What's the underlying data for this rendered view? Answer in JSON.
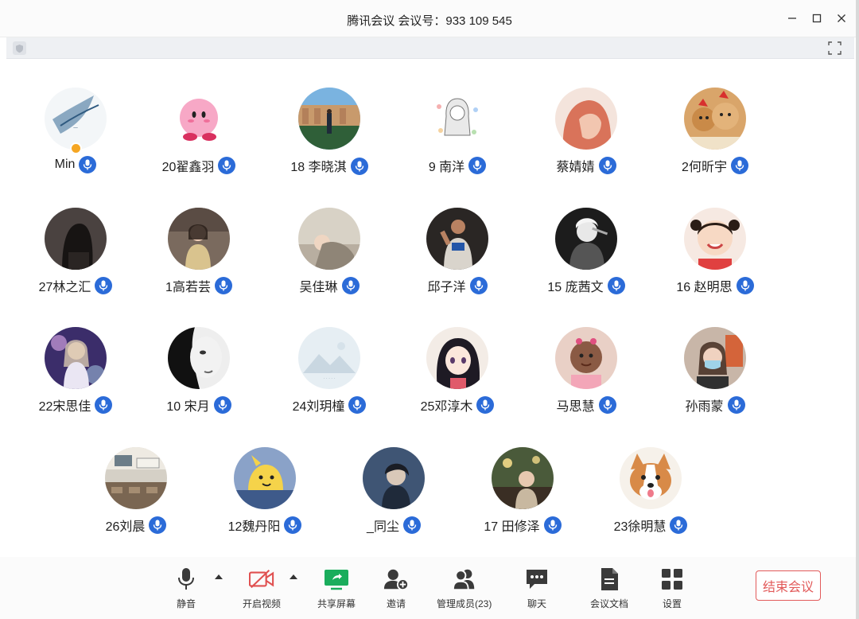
{
  "window": {
    "title": "腾讯会议  会议号：933 109 545"
  },
  "participants": [
    {
      "name": "Min",
      "avatar": "blue-ink-sketch",
      "host": true
    },
    {
      "name": "20翟鑫羽",
      "avatar": "pink-kirby"
    },
    {
      "name": "18 李晓淇",
      "avatar": "person-at-plaza"
    },
    {
      "name": "9 南洋",
      "avatar": "anime-girl-sketch"
    },
    {
      "name": "蔡婧婧",
      "avatar": "portrait-coral"
    },
    {
      "name": "2何昕宇",
      "avatar": "shiba-dogs"
    },
    {
      "name": "27林之汇",
      "avatar": "dark-portrait"
    },
    {
      "name": "1高若芸",
      "avatar": "girl-in-street"
    },
    {
      "name": "吴佳琳",
      "avatar": "sleeping-figure"
    },
    {
      "name": "邱子洋",
      "avatar": "basketball-player"
    },
    {
      "name": "15 庞茜文",
      "avatar": "bw-portrait"
    },
    {
      "name": "16 赵明思",
      "avatar": "smiling-child"
    },
    {
      "name": "22宋思佳",
      "avatar": "stage-performer"
    },
    {
      "name": "10 宋月",
      "avatar": "bw-face-closeup"
    },
    {
      "name": "24刘玥橦",
      "avatar": "default-landscape"
    },
    {
      "name": "25邓淳木",
      "avatar": "anime-girl"
    },
    {
      "name": "马思慧",
      "avatar": "baby-portrait"
    },
    {
      "name": "孙雨蒙",
      "avatar": "masked-girl"
    },
    {
      "name": "26刘晨",
      "avatar": "classroom"
    },
    {
      "name": "12魏丹阳",
      "avatar": "yellow-cartoon"
    },
    {
      "name": "_同尘",
      "avatar": "dark-illustration"
    },
    {
      "name": "17 田修泽",
      "avatar": "cafe-scene"
    },
    {
      "name": "23徐明慧",
      "avatar": "corgi"
    }
  ],
  "toolbar": {
    "mute": "静音",
    "video": "开启视频",
    "share": "共享屏幕",
    "invite": "邀请",
    "members": "管理成员(23)",
    "chat": "聊天",
    "docs": "会议文档",
    "settings": "设置",
    "end": "结束会议"
  },
  "colors": {
    "accent": "#2b6bd8",
    "end_red": "#e25a5a",
    "share_green": "#1aad5c",
    "video_red": "#e05050"
  }
}
